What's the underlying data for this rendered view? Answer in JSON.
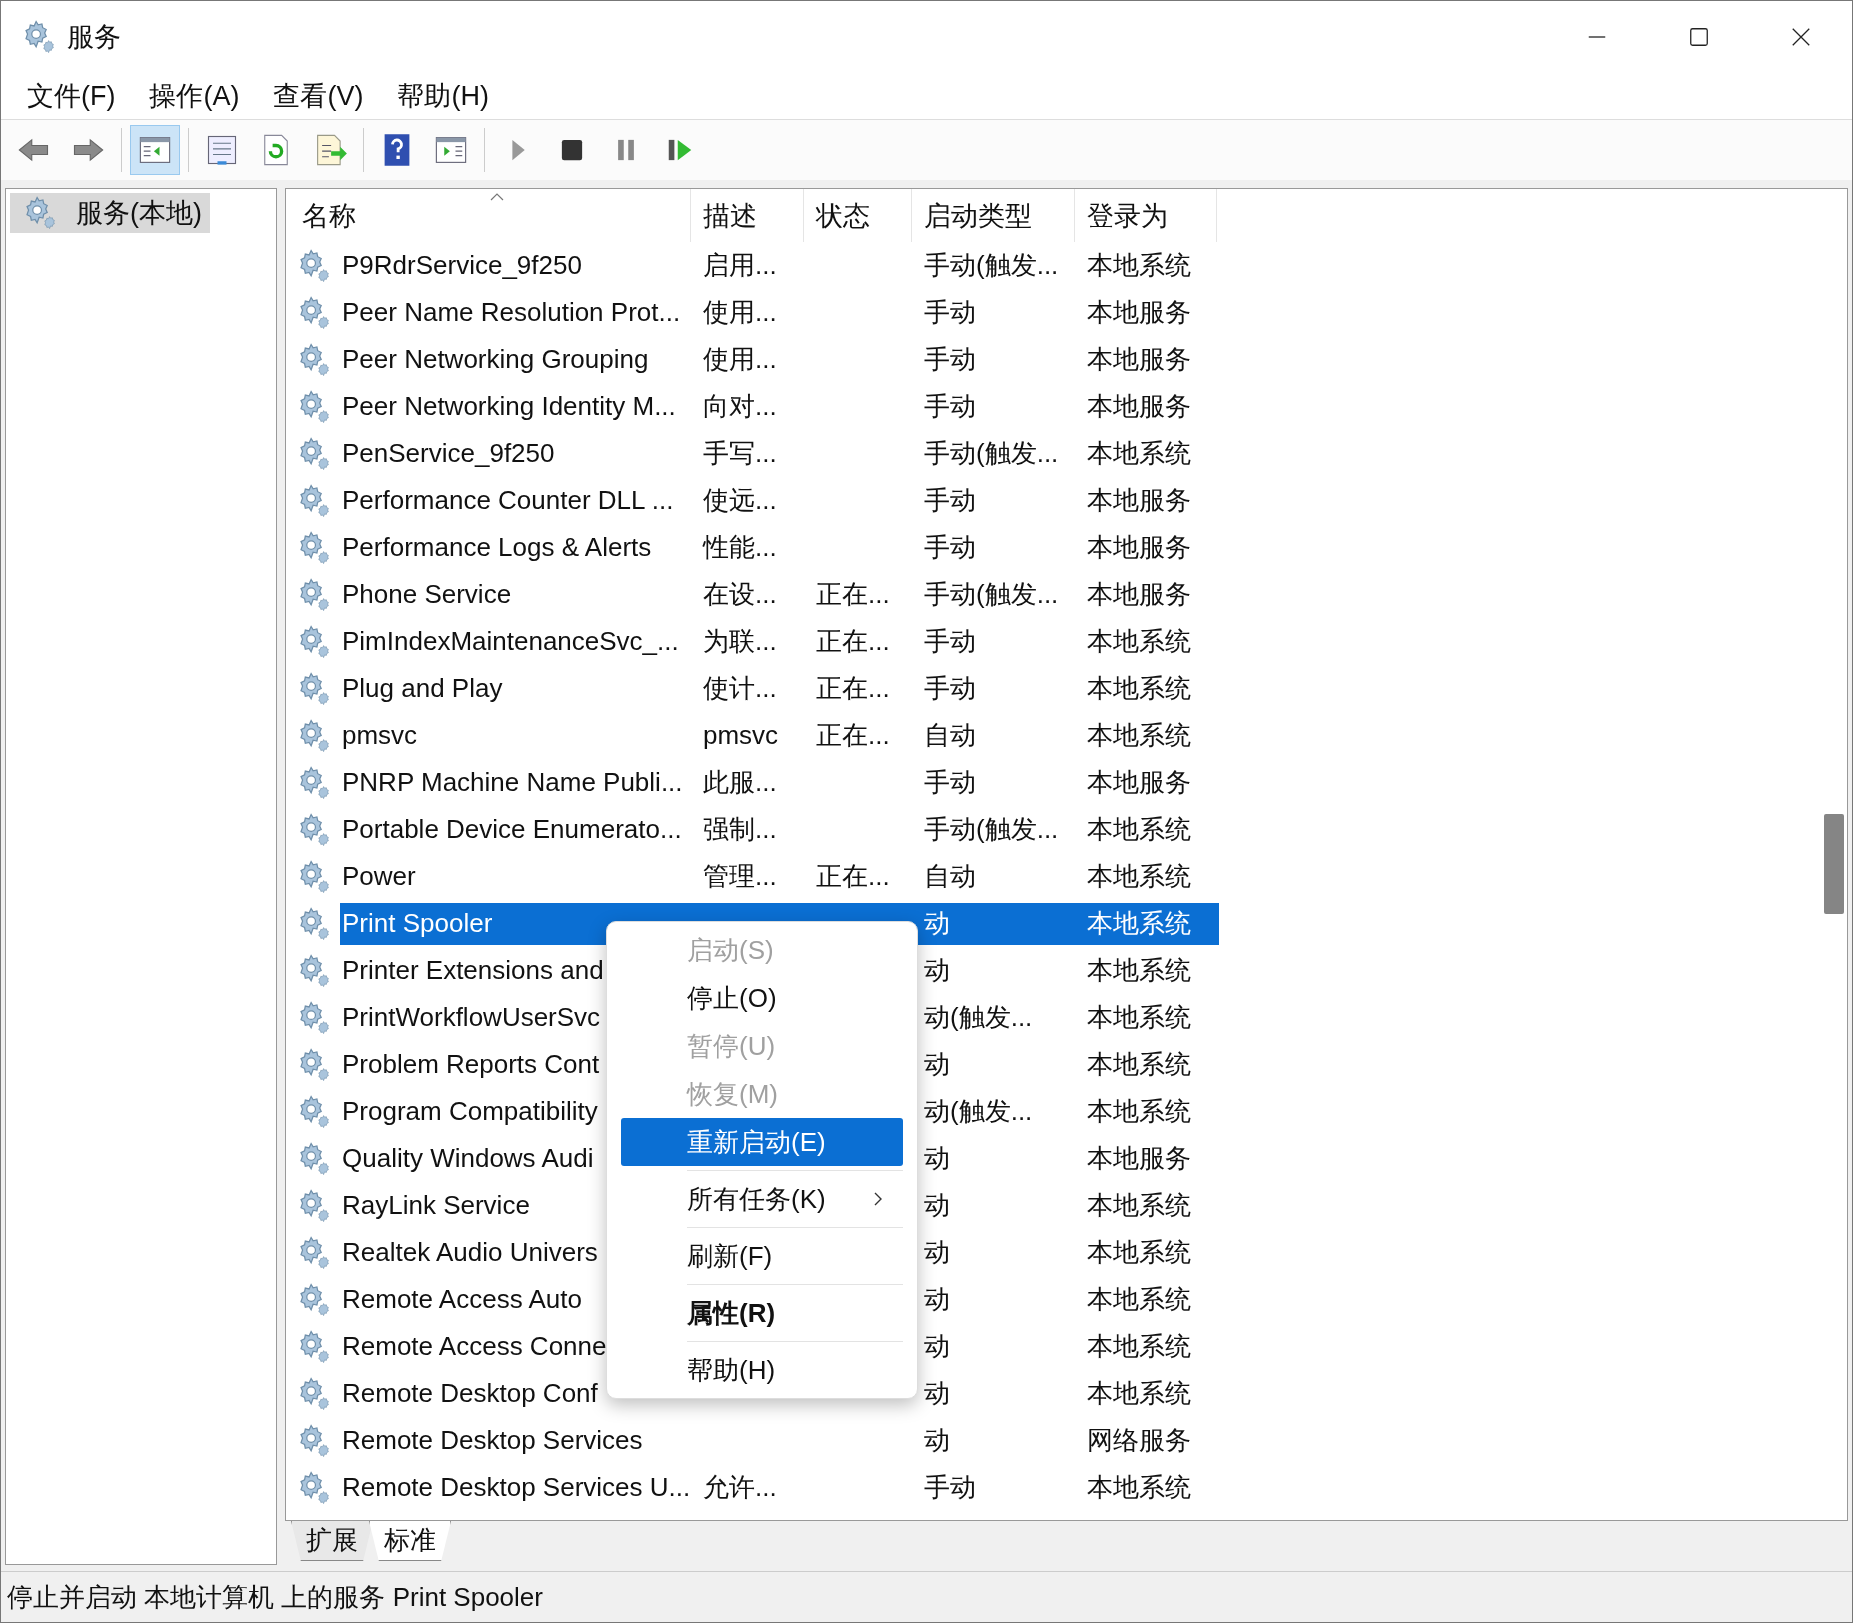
{
  "window": {
    "title": "服务"
  },
  "menu_bar": [
    "文件(F)",
    "操作(A)",
    "查看(V)",
    "帮助(H)"
  ],
  "toolbar": [
    {
      "kind": "back",
      "pressed": false
    },
    {
      "kind": "forward",
      "pressed": false
    },
    {
      "kind": "sep"
    },
    {
      "kind": "tree",
      "pressed": true
    },
    {
      "kind": "sep"
    },
    {
      "kind": "props",
      "pressed": false
    },
    {
      "kind": "refresh",
      "pressed": false
    },
    {
      "kind": "export",
      "pressed": false
    },
    {
      "kind": "sep"
    },
    {
      "kind": "help",
      "pressed": false
    },
    {
      "kind": "pane",
      "pressed": false
    },
    {
      "kind": "sep"
    },
    {
      "kind": "play",
      "pressed": false
    },
    {
      "kind": "stop",
      "pressed": false
    },
    {
      "kind": "pause",
      "pressed": false
    },
    {
      "kind": "resume",
      "pressed": false
    }
  ],
  "tree": [
    {
      "label": "服务(本地)",
      "selected": true
    }
  ],
  "table": {
    "columns": [
      "名称",
      "描述",
      "状态",
      "启动类型",
      "登录为"
    ],
    "rows": [
      {
        "name": "P9RdrService_9f250",
        "desc": "启用...",
        "status": "",
        "startup": "手动(触发...",
        "logon": "本地系统",
        "selected": false
      },
      {
        "name": "Peer Name Resolution Prot...",
        "desc": "使用...",
        "status": "",
        "startup": "手动",
        "logon": "本地服务",
        "selected": false
      },
      {
        "name": "Peer Networking Grouping",
        "desc": "使用...",
        "status": "",
        "startup": "手动",
        "logon": "本地服务",
        "selected": false
      },
      {
        "name": "Peer Networking Identity M...",
        "desc": "向对...",
        "status": "",
        "startup": "手动",
        "logon": "本地服务",
        "selected": false
      },
      {
        "name": "PenService_9f250",
        "desc": "手写...",
        "status": "",
        "startup": "手动(触发...",
        "logon": "本地系统",
        "selected": false
      },
      {
        "name": "Performance Counter DLL ...",
        "desc": "使远...",
        "status": "",
        "startup": "手动",
        "logon": "本地服务",
        "selected": false
      },
      {
        "name": "Performance Logs & Alerts",
        "desc": "性能...",
        "status": "",
        "startup": "手动",
        "logon": "本地服务",
        "selected": false
      },
      {
        "name": "Phone Service",
        "desc": "在设...",
        "status": "正在...",
        "startup": "手动(触发...",
        "logon": "本地服务",
        "selected": false
      },
      {
        "name": "PimIndexMaintenanceSvc_...",
        "desc": "为联...",
        "status": "正在...",
        "startup": "手动",
        "logon": "本地系统",
        "selected": false
      },
      {
        "name": "Plug and Play",
        "desc": "使计...",
        "status": "正在...",
        "startup": "手动",
        "logon": "本地系统",
        "selected": false
      },
      {
        "name": "pmsvc",
        "desc": "pmsvc",
        "status": "正在...",
        "startup": "自动",
        "logon": "本地系统",
        "selected": false
      },
      {
        "name": "PNRP Machine Name Publi...",
        "desc": "此服...",
        "status": "",
        "startup": "手动",
        "logon": "本地服务",
        "selected": false
      },
      {
        "name": "Portable Device Enumerato...",
        "desc": "强制...",
        "status": "",
        "startup": "手动(触发...",
        "logon": "本地系统",
        "selected": false
      },
      {
        "name": "Power",
        "desc": "管理...",
        "status": "正在...",
        "startup": "自动",
        "logon": "本地系统",
        "selected": false
      },
      {
        "name": "Print Spooler",
        "desc": "",
        "status": "",
        "startup": "动",
        "logon": "本地系统",
        "selected": true
      },
      {
        "name": "Printer Extensions and",
        "desc": "",
        "status": "",
        "startup": "动",
        "logon": "本地系统",
        "selected": false
      },
      {
        "name": "PrintWorkflowUserSvc",
        "desc": "",
        "status": "",
        "startup": "动(触发...",
        "logon": "本地系统",
        "selected": false
      },
      {
        "name": "Problem Reports Cont",
        "desc": "",
        "status": "",
        "startup": "动",
        "logon": "本地系统",
        "selected": false
      },
      {
        "name": "Program Compatibility",
        "desc": "",
        "status": "",
        "startup": "动(触发...",
        "logon": "本地系统",
        "selected": false
      },
      {
        "name": "Quality Windows Audi",
        "desc": "",
        "status": "",
        "startup": "动",
        "logon": "本地服务",
        "selected": false
      },
      {
        "name": "RayLink Service",
        "desc": "",
        "status": "",
        "startup": "动",
        "logon": "本地系统",
        "selected": false
      },
      {
        "name": "Realtek Audio Univers",
        "desc": "",
        "status": "",
        "startup": "动",
        "logon": "本地系统",
        "selected": false
      },
      {
        "name": "Remote Access Auto",
        "desc": "",
        "status": "",
        "startup": "动",
        "logon": "本地系统",
        "selected": false
      },
      {
        "name": "Remote Access Conne",
        "desc": "",
        "status": "",
        "startup": "动",
        "logon": "本地系统",
        "selected": false
      },
      {
        "name": "Remote Desktop Conf",
        "desc": "",
        "status": "",
        "startup": "动",
        "logon": "本地系统",
        "selected": false
      },
      {
        "name": "Remote Desktop Services",
        "desc": "",
        "status": "",
        "startup": "动",
        "logon": "网络服务",
        "selected": false
      },
      {
        "name": "Remote Desktop Services U...",
        "desc": "允许...",
        "status": "",
        "startup": "手动",
        "logon": "本地系统",
        "selected": false
      }
    ]
  },
  "context_menu": [
    {
      "kind": "item",
      "label": "启动(S)",
      "disabled": true,
      "selected": false
    },
    {
      "kind": "item",
      "label": "停止(O)",
      "disabled": false,
      "selected": false
    },
    {
      "kind": "item",
      "label": "暂停(U)",
      "disabled": true,
      "selected": false
    },
    {
      "kind": "item",
      "label": "恢复(M)",
      "disabled": true,
      "selected": false
    },
    {
      "kind": "item",
      "label": "重新启动(E)",
      "disabled": false,
      "selected": true
    },
    {
      "kind": "sep"
    },
    {
      "kind": "submenu",
      "label": "所有任务(K)",
      "disabled": false,
      "selected": false
    },
    {
      "kind": "sep"
    },
    {
      "kind": "item",
      "label": "刷新(F)",
      "disabled": false,
      "selected": false
    },
    {
      "kind": "sep"
    },
    {
      "kind": "default",
      "label": "属性(R)",
      "disabled": false,
      "selected": false
    },
    {
      "kind": "sep"
    },
    {
      "kind": "item",
      "label": "帮助(H)",
      "disabled": false,
      "selected": false
    }
  ],
  "view_tabs": [
    {
      "label": "扩展",
      "selected": false
    },
    {
      "label": "标准",
      "selected": true
    }
  ],
  "status_bar": "停止并启动 本地计算机 上的服务 Print Spooler"
}
